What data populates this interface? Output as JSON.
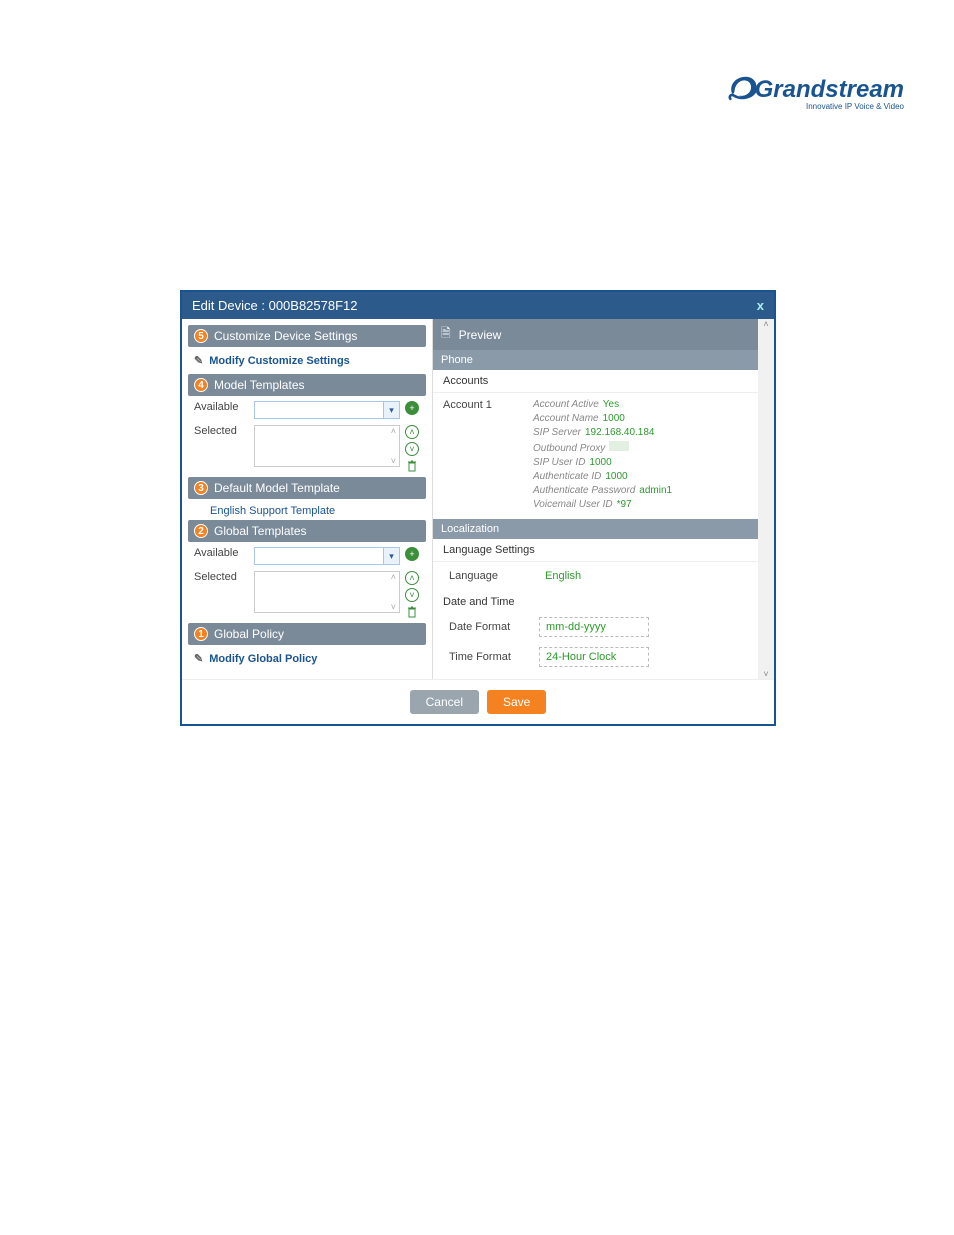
{
  "logo": {
    "brand": "Grandstream",
    "tagline": "Innovative IP Voice & Video"
  },
  "dialog": {
    "title": "Edit Device : 000B82578F12",
    "close": "x"
  },
  "left": {
    "customize": {
      "badge": "5",
      "label": "Customize Device Settings"
    },
    "modifyCustomize": "Modify Customize Settings",
    "modelTemplates": {
      "badge": "4",
      "label": "Model Templates",
      "available": "Available",
      "selected": "Selected"
    },
    "defaultModel": {
      "badge": "3",
      "label": "Default Model Template",
      "item": "English Support Template"
    },
    "globalTemplates": {
      "badge": "2",
      "label": "Global Templates",
      "available": "Available",
      "selected": "Selected"
    },
    "globalPolicy": {
      "badge": "1",
      "label": "Global Policy"
    },
    "modifyGlobal": "Modify Global Policy"
  },
  "right": {
    "preview": "Preview",
    "phone": "Phone",
    "accounts": "Accounts",
    "account1": {
      "label": "Account 1",
      "fields": {
        "active": {
          "k": "Account Active",
          "v": "Yes"
        },
        "name": {
          "k": "Account Name",
          "v": "1000"
        },
        "sipServer": {
          "k": "SIP Server",
          "v": "192.168.40.184"
        },
        "outProxy": {
          "k": "Outbound Proxy",
          "v": ""
        },
        "sipUser": {
          "k": "SIP User ID",
          "v": "1000"
        },
        "authId": {
          "k": "Authenticate ID",
          "v": "1000"
        },
        "authPw": {
          "k": "Authenticate Password",
          "v": "admin1"
        },
        "vmId": {
          "k": "Voicemail User ID",
          "v": "*97"
        }
      }
    },
    "localization": "Localization",
    "langSettings": "Language Settings",
    "language": {
      "k": "Language",
      "v": "English"
    },
    "dateTime": "Date and Time",
    "dateFormat": {
      "k": "Date Format",
      "v": "mm-dd-yyyy"
    },
    "timeFormat": {
      "k": "Time Format",
      "v": "24-Hour Clock"
    }
  },
  "footer": {
    "cancel": "Cancel",
    "save": "Save"
  }
}
